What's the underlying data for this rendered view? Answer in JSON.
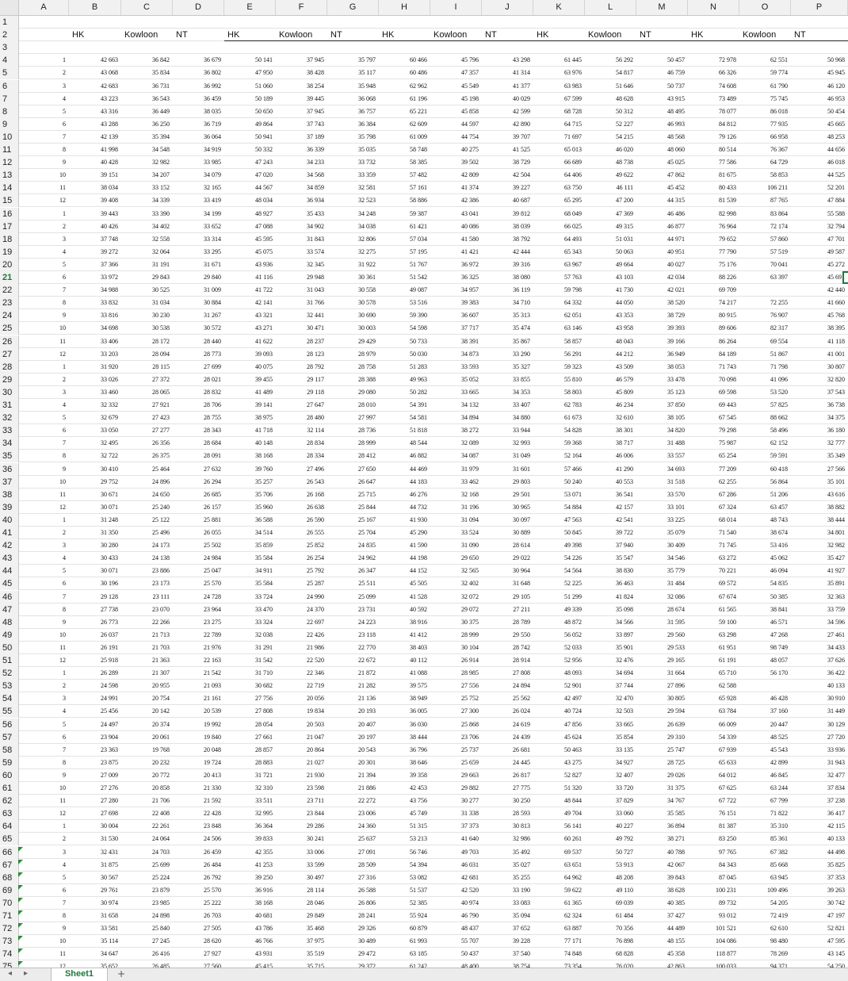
{
  "columns": [
    "A",
    "B",
    "C",
    "D",
    "E",
    "F",
    "G",
    "H",
    "I",
    "J",
    "K",
    "L",
    "M",
    "N",
    "O",
    "P"
  ],
  "header_labels": [
    "HK",
    "Kowloon",
    "NT",
    "HK",
    "Kowloon",
    "NT",
    "HK",
    "Kowloon",
    "NT",
    "HK",
    "Kowloon",
    "NT",
    "HK",
    "Kowloon",
    "NT"
  ],
  "selected_row": 21,
  "flag_rows": [
    66,
    67,
    68,
    69,
    70,
    71,
    72,
    73,
    74,
    75
  ],
  "rows": [
    [
      "1",
      "42 663",
      "36 842",
      "36 679",
      "50 141",
      "37 945",
      "35 797",
      "60 466",
      "45 796",
      "43 298",
      "61 445",
      "56 292",
      "50 457",
      "72 978",
      "62 551",
      "50 968"
    ],
    [
      "2",
      "43 068",
      "35 834",
      "36 802",
      "47 950",
      "38 428",
      "35 117",
      "60 486",
      "47 357",
      "41 314",
      "63 976",
      "54 817",
      "46 759",
      "66 326",
      "59 774",
      "45 945"
    ],
    [
      "3",
      "42 683",
      "36 731",
      "36 992",
      "51 060",
      "38 254",
      "35 948",
      "62 962",
      "45 549",
      "41 377",
      "63 983",
      "51 646",
      "50 737",
      "74 608",
      "61 790",
      "46 120"
    ],
    [
      "4",
      "43 223",
      "36 543",
      "36 459",
      "50 189",
      "39 445",
      "36 068",
      "61 196",
      "45 198",
      "40 029",
      "67 599",
      "48 628",
      "43 915",
      "73 489",
      "75 745",
      "46 953"
    ],
    [
      "5",
      "43 316",
      "36 449",
      "38 035",
      "50 650",
      "37 945",
      "36 757",
      "65 221",
      "45 858",
      "42 599",
      "68 728",
      "50 312",
      "48 495",
      "78 077",
      "86 018",
      "50 454"
    ],
    [
      "6",
      "43 288",
      "36 250",
      "36 719",
      "49 864",
      "37 743",
      "36 384",
      "62 609",
      "44 597",
      "42 890",
      "64 715",
      "52 227",
      "46 993",
      "84 812",
      "77 935",
      "45 665"
    ],
    [
      "7",
      "42 139",
      "35 394",
      "36 064",
      "50 941",
      "37 189",
      "35 798",
      "61 009",
      "44 754",
      "39 707",
      "71 697",
      "54 215",
      "48 568",
      "79 126",
      "66 958",
      "48 253"
    ],
    [
      "8",
      "41 998",
      "34 548",
      "34 919",
      "50 332",
      "36 339",
      "35 035",
      "58 748",
      "40 275",
      "41 525",
      "65 013",
      "46 020",
      "48 060",
      "80 514",
      "76 367",
      "44 656"
    ],
    [
      "9",
      "40 428",
      "32 982",
      "33 985",
      "47 243",
      "34 233",
      "33 732",
      "58 385",
      "39 502",
      "38 729",
      "66 689",
      "48 738",
      "45 025",
      "77 586",
      "64 729",
      "46 018"
    ],
    [
      "10",
      "39 151",
      "34 207",
      "34 079",
      "47 020",
      "34 568",
      "33 359",
      "57 482",
      "42 809",
      "42 504",
      "64 406",
      "49 622",
      "47 862",
      "81 675",
      "58 853",
      "44 525"
    ],
    [
      "11",
      "38 034",
      "33 152",
      "32 165",
      "44 567",
      "34 859",
      "32 581",
      "57 161",
      "41 374",
      "39 227",
      "63 750",
      "46 111",
      "45 452",
      "80 433",
      "106 211",
      "52 201"
    ],
    [
      "12",
      "39 408",
      "34 339",
      "33 419",
      "48 034",
      "36 934",
      "32 523",
      "58 886",
      "42 386",
      "40 687",
      "65 295",
      "47 200",
      "44 315",
      "81 539",
      "87 765",
      "47 884"
    ],
    [
      "1",
      "39 443",
      "33 390",
      "34 199",
      "48 927",
      "35 433",
      "34 248",
      "59 387",
      "43 041",
      "39 812",
      "68 049",
      "47 369",
      "46 486",
      "82 998",
      "83 864",
      "55 588"
    ],
    [
      "2",
      "40 426",
      "34 402",
      "33 652",
      "47 088",
      "34 902",
      "34 038",
      "61 421",
      "40 086",
      "38 039",
      "66 025",
      "49 315",
      "46 877",
      "76 964",
      "72 174",
      "32 794"
    ],
    [
      "3",
      "37 748",
      "32 558",
      "33 314",
      "45 595",
      "31 843",
      "32 806",
      "57 034",
      "41 580",
      "38 792",
      "64 493",
      "51 031",
      "44 971",
      "79 652",
      "57 860",
      "47 701"
    ],
    [
      "4",
      "39 272",
      "32 064",
      "33 295",
      "45 075",
      "33 574",
      "32 275",
      "57 195",
      "41 421",
      "42 444",
      "65 343",
      "50 063",
      "40 951",
      "77 790",
      "57 519",
      "49 587"
    ],
    [
      "5",
      "37 366",
      "31 191",
      "31 671",
      "43 936",
      "32 345",
      "31 922",
      "51 767",
      "36 972",
      "39 316",
      "63 967",
      "49 664",
      "40 027",
      "75 176",
      "70 041",
      "45 272"
    ],
    [
      "6",
      "33 972",
      "29 843",
      "29 840",
      "41 116",
      "29 948",
      "30 361",
      "51 542",
      "36 325",
      "38 080",
      "57 763",
      "43 103",
      "42 034",
      "88 226",
      "63 397",
      "45 691"
    ],
    [
      "7",
      "34 988",
      "30 525",
      "31 009",
      "41 722",
      "31 043",
      "30 558",
      "49 087",
      "34 957",
      "36 119",
      "59 798",
      "41 730",
      "42 021",
      "69 709",
      "",
      "42 440"
    ],
    [
      "8",
      "33 832",
      "31 034",
      "30 884",
      "42 141",
      "31 766",
      "30 578",
      "53 516",
      "39 383",
      "34 710",
      "64 332",
      "44 050",
      "38 520",
      "74 217",
      "72 255",
      "41 660"
    ],
    [
      "9",
      "33 816",
      "30 230",
      "31 267",
      "43 321",
      "32 441",
      "30 690",
      "59 390",
      "36 607",
      "35 313",
      "62 051",
      "43 353",
      "38 729",
      "80 915",
      "76 907",
      "45 768"
    ],
    [
      "10",
      "34 698",
      "30 538",
      "30 572",
      "43 271",
      "30 471",
      "30 003",
      "54 598",
      "37 717",
      "35 474",
      "63 146",
      "43 958",
      "39 393",
      "89 606",
      "82 317",
      "38 395"
    ],
    [
      "11",
      "33 406",
      "28 172",
      "28 440",
      "41 622",
      "28 237",
      "29 429",
      "50 733",
      "38 391",
      "35 867",
      "58 857",
      "48 043",
      "39 166",
      "86 264",
      "69 554",
      "41 118"
    ],
    [
      "12",
      "33 203",
      "28 094",
      "28 773",
      "39 093",
      "28 123",
      "28 979",
      "50 030",
      "34 873",
      "33 290",
      "56 291",
      "44 212",
      "36 949",
      "84 189",
      "51 867",
      "41 001"
    ],
    [
      "1",
      "31 920",
      "28 115",
      "27 699",
      "40 075",
      "28 792",
      "28 758",
      "51 283",
      "33 593",
      "35 327",
      "59 323",
      "43 509",
      "38 053",
      "71 743",
      "71 798",
      "30 807"
    ],
    [
      "2",
      "33 026",
      "27 372",
      "28 021",
      "39 455",
      "29 117",
      "28 388",
      "49 963",
      "35 052",
      "33 855",
      "55 810",
      "46 579",
      "33 478",
      "70 098",
      "41 096",
      "32 820"
    ],
    [
      "3",
      "33 460",
      "28 065",
      "28 832",
      "41 489",
      "29 118",
      "29 080",
      "50 282",
      "33 665",
      "34 353",
      "58 803",
      "45 809",
      "35 123",
      "69 598",
      "53 520",
      "37 543"
    ],
    [
      "4",
      "32 332",
      "27 921",
      "28 706",
      "39 141",
      "27 647",
      "28 010",
      "54 391",
      "34 132",
      "33 407",
      "62 783",
      "46 234",
      "37 850",
      "69 443",
      "57 825",
      "36 738"
    ],
    [
      "5",
      "32 679",
      "27 423",
      "28 755",
      "38 975",
      "28 480",
      "27 997",
      "54 581",
      "34 894",
      "34 880",
      "61 673",
      "32 610",
      "38 105",
      "67 545",
      "88 662",
      "34 375"
    ],
    [
      "6",
      "33 050",
      "27 277",
      "28 343",
      "41 718",
      "32 114",
      "28 736",
      "51 818",
      "38 272",
      "33 944",
      "54 828",
      "38 301",
      "34 820",
      "79 298",
      "58 496",
      "36 180"
    ],
    [
      "7",
      "32 495",
      "26 356",
      "28 684",
      "40 148",
      "28 834",
      "28 999",
      "48 544",
      "32 089",
      "32 993",
      "59 368",
      "38 717",
      "31 488",
      "75 987",
      "62 152",
      "32 777"
    ],
    [
      "8",
      "32 722",
      "26 375",
      "28 091",
      "38 168",
      "28 334",
      "28 412",
      "46 882",
      "34 087",
      "31 049",
      "52 164",
      "46 006",
      "33 557",
      "65 254",
      "59 591",
      "35 349"
    ],
    [
      "9",
      "30 410",
      "25 464",
      "27 632",
      "39 760",
      "27 496",
      "27 650",
      "44 469",
      "31 979",
      "31 601",
      "57 466",
      "41 290",
      "34 693",
      "77 209",
      "60 418",
      "27 566"
    ],
    [
      "10",
      "29 752",
      "24 896",
      "26 294",
      "35 257",
      "26 543",
      "26 647",
      "44 183",
      "33 462",
      "29 803",
      "50 240",
      "40 553",
      "31 518",
      "62 255",
      "56 864",
      "35 101"
    ],
    [
      "11",
      "30 671",
      "24 650",
      "26 685",
      "35 706",
      "26 168",
      "25 715",
      "46 276",
      "32 168",
      "29 501",
      "53 071",
      "36 541",
      "33 570",
      "67 286",
      "51 206",
      "43 616"
    ],
    [
      "12",
      "30 071",
      "25 240",
      "26 157",
      "35 960",
      "26 638",
      "25 844",
      "44 732",
      "31 196",
      "30 965",
      "54 884",
      "42 157",
      "33 101",
      "67 324",
      "63 457",
      "38 882"
    ],
    [
      "1",
      "31 248",
      "25 122",
      "25 881",
      "36 588",
      "26 590",
      "25 167",
      "41 930",
      "31 094",
      "30 097",
      "47 563",
      "42 541",
      "33 225",
      "68 014",
      "48 743",
      "38 444"
    ],
    [
      "2",
      "31 350",
      "25 496",
      "26 055",
      "34 514",
      "26 555",
      "25 704",
      "45 290",
      "33 524",
      "30 889",
      "50 845",
      "39 722",
      "35 079",
      "71 540",
      "38 674",
      "34 801"
    ],
    [
      "3",
      "30 280",
      "24 173",
      "25 502",
      "35 859",
      "25 852",
      "24 835",
      "41 590",
      "31 090",
      "28 614",
      "49 398",
      "37 940",
      "30 409",
      "71 745",
      "53 416",
      "32 982"
    ],
    [
      "4",
      "30 433",
      "24 138",
      "24 984",
      "35 584",
      "26 254",
      "24 962",
      "44 198",
      "29 650",
      "29 022",
      "54 226",
      "35 547",
      "34 546",
      "63 272",
      "45 062",
      "35 427"
    ],
    [
      "5",
      "30 071",
      "23 886",
      "25 047",
      "34 911",
      "25 792",
      "26 347",
      "44 152",
      "32 565",
      "30 964",
      "54 564",
      "38 830",
      "35 779",
      "70 221",
      "46 094",
      "41 927"
    ],
    [
      "6",
      "30 196",
      "23 173",
      "25 570",
      "35 584",
      "25 287",
      "25 511",
      "45 505",
      "32 402",
      "31 648",
      "52 225",
      "36 463",
      "31 484",
      "69 572",
      "54 835",
      "35 891"
    ],
    [
      "7",
      "29 128",
      "23 111",
      "24 728",
      "33 724",
      "24 990",
      "25 099",
      "41 528",
      "32 072",
      "29 105",
      "51 299",
      "41 824",
      "32 086",
      "67 674",
      "50 385",
      "32 363"
    ],
    [
      "8",
      "27 738",
      "23 070",
      "23 964",
      "33 470",
      "24 370",
      "23 731",
      "40 592",
      "29 072",
      "27 211",
      "49 339",
      "35 098",
      "28 674",
      "61 565",
      "38 841",
      "33 759"
    ],
    [
      "9",
      "26 773",
      "22 266",
      "23 275",
      "33 324",
      "22 697",
      "24 223",
      "38 916",
      "30 375",
      "28 789",
      "48 872",
      "34 566",
      "31 595",
      "59 100",
      "46 571",
      "34 596"
    ],
    [
      "10",
      "26 037",
      "21 713",
      "22 789",
      "32 038",
      "22 426",
      "23 118",
      "41 412",
      "28 999",
      "29 550",
      "56 052",
      "33 897",
      "29 560",
      "63 298",
      "47 268",
      "27 461"
    ],
    [
      "11",
      "26 191",
      "21 703",
      "21 976",
      "31 291",
      "21 986",
      "22 770",
      "38 403",
      "30 104",
      "28 742",
      "52 033",
      "35 901",
      "29 533",
      "61 951",
      "98 749",
      "34 433"
    ],
    [
      "12",
      "25 918",
      "21 363",
      "22 163",
      "31 542",
      "22 520",
      "22 672",
      "40 112",
      "26 914",
      "28 914",
      "52 956",
      "32 476",
      "29 165",
      "61 191",
      "48 057",
      "37 626"
    ],
    [
      "1",
      "26 289",
      "21 307",
      "21 542",
      "31 710",
      "22 346",
      "21 872",
      "41 088",
      "28 985",
      "27 808",
      "48 093",
      "34 694",
      "31 664",
      "65 710",
      "56 170",
      "36 422"
    ],
    [
      "2",
      "24 598",
      "20 955",
      "21 093",
      "30 682",
      "22 719",
      "21 282",
      "39 575",
      "27 556",
      "24 894",
      "52 901",
      "37 744",
      "27 896",
      "62 588",
      "",
      "40 133"
    ],
    [
      "3",
      "24 991",
      "20 754",
      "21 161",
      "27 756",
      "20 056",
      "21 136",
      "38 949",
      "25 752",
      "25 562",
      "42 497",
      "32 470",
      "30 805",
      "65 928",
      "46 428",
      "30 910"
    ],
    [
      "4",
      "25 456",
      "20 142",
      "20 539",
      "27 808",
      "19 834",
      "20 193",
      "36 005",
      "27 300",
      "26 024",
      "40 724",
      "32 503",
      "29 594",
      "63 784",
      "37 160",
      "31 449"
    ],
    [
      "5",
      "24 497",
      "20 374",
      "19 992",
      "28 054",
      "20 503",
      "20 407",
      "36 030",
      "25 868",
      "24 619",
      "47 856",
      "33 665",
      "26 639",
      "66 009",
      "20 447",
      "30 129"
    ],
    [
      "6",
      "23 904",
      "20 061",
      "19 840",
      "27 661",
      "21 047",
      "20 197",
      "38 444",
      "23 706",
      "24 439",
      "45 624",
      "35 854",
      "29 310",
      "54 339",
      "48 525",
      "27 720"
    ],
    [
      "7",
      "23 363",
      "19 768",
      "20 048",
      "28 857",
      "20 864",
      "20 543",
      "36 796",
      "25 737",
      "26 681",
      "50 463",
      "33 135",
      "25 747",
      "67 939",
      "45 543",
      "33 936"
    ],
    [
      "8",
      "23 875",
      "20 232",
      "19 724",
      "28 883",
      "21 027",
      "20 301",
      "38 646",
      "25 659",
      "24 445",
      "43 275",
      "34 927",
      "28 725",
      "65 633",
      "42 899",
      "31 943"
    ],
    [
      "9",
      "27 009",
      "20 772",
      "20 413",
      "31 721",
      "21 930",
      "21 394",
      "39 358",
      "29 663",
      "26 817",
      "52 827",
      "32 407",
      "29 026",
      "64 012",
      "46 845",
      "32 477"
    ],
    [
      "10",
      "27 276",
      "20 858",
      "21 330",
      "32 310",
      "23 598",
      "21 886",
      "42 453",
      "29 882",
      "27 775",
      "51 320",
      "33 720",
      "31 375",
      "67 625",
      "63 244",
      "37 834"
    ],
    [
      "11",
      "27 280",
      "21 706",
      "21 592",
      "33 511",
      "23 711",
      "22 272",
      "43 756",
      "30 277",
      "30 250",
      "48 844",
      "37 829",
      "34 767",
      "67 722",
      "67 799",
      "37 238"
    ],
    [
      "12",
      "27 698",
      "22 408",
      "22 428",
      "32 995",
      "23 844",
      "23 006",
      "45 749",
      "31 338",
      "28 593",
      "49 704",
      "33 060",
      "35 585",
      "76 151",
      "71 822",
      "36 417"
    ],
    [
      "1",
      "30 004",
      "22 261",
      "23 848",
      "36 364",
      "29 286",
      "24 360",
      "51 315",
      "37 373",
      "30 813",
      "56 141",
      "40 227",
      "36 894",
      "81 387",
      "35 310",
      "42 115"
    ],
    [
      "2",
      "31 530",
      "24 064",
      "24 506",
      "39 833",
      "30 241",
      "25 637",
      "53 213",
      "41 640",
      "32 986",
      "60 261",
      "49 792",
      "38 271",
      "83 250",
      "85 361",
      "40 133"
    ],
    [
      "3",
      "32 431",
      "24 703",
      "26 459",
      "42 355",
      "33 006",
      "27 091",
      "56 746",
      "49 703",
      "35 492",
      "69 537",
      "50 727",
      "40 788",
      "97 765",
      "67 382",
      "44 498"
    ],
    [
      "4",
      "31 875",
      "25 699",
      "26 484",
      "41 253",
      "33 599",
      "28 509",
      "54 394",
      "46 031",
      "35 027",
      "63 651",
      "53 913",
      "42 067",
      "84 343",
      "85 668",
      "35 825"
    ],
    [
      "5",
      "30 567",
      "25 224",
      "26 792",
      "39 250",
      "30 497",
      "27 316",
      "53 082",
      "42 681",
      "35 255",
      "64 962",
      "48 208",
      "39 843",
      "87 045",
      "63 945",
      "37 353"
    ],
    [
      "6",
      "29 761",
      "23 879",
      "25 570",
      "36 916",
      "28 114",
      "26 588",
      "51 537",
      "42 520",
      "33 190",
      "59 622",
      "49 110",
      "38 628",
      "100 231",
      "109 496",
      "39 263"
    ],
    [
      "7",
      "30 974",
      "23 985",
      "25 222",
      "38 168",
      "28 046",
      "26 806",
      "52 385",
      "40 974",
      "33 083",
      "61 365",
      "69 039",
      "40 385",
      "89 732",
      "54 205",
      "30 742"
    ],
    [
      "8",
      "31 658",
      "24 898",
      "26 703",
      "40 681",
      "29 849",
      "28 241",
      "55 924",
      "46 790",
      "35 094",
      "62 324",
      "61 484",
      "37 427",
      "93 012",
      "72 419",
      "47 197"
    ],
    [
      "9",
      "33 581",
      "25 840",
      "27 505",
      "43 786",
      "35 468",
      "29 326",
      "60 879",
      "48 437",
      "37 652",
      "63 887",
      "70 356",
      "44 489",
      "101 521",
      "62 610",
      "52 821"
    ],
    [
      "10",
      "35 114",
      "27 245",
      "28 620",
      "46 766",
      "37 975",
      "30 489",
      "61 993",
      "55 707",
      "39 228",
      "77 171",
      "76 898",
      "48 155",
      "104 086",
      "98 480",
      "47 595"
    ],
    [
      "11",
      "34 647",
      "26 416",
      "27 927",
      "43 931",
      "35 519",
      "29 472",
      "63 185",
      "50 437",
      "37 540",
      "74 848",
      "68 828",
      "45 358",
      "118 877",
      "78 269",
      "43 145"
    ],
    [
      "12",
      "35 652",
      "26 485",
      "27 560",
      "45 415",
      "35 715",
      "29 372",
      "61 242",
      "48 400",
      "38 754",
      "73 354",
      "76 020",
      "42 863",
      "100 033",
      "94 371",
      "54 250"
    ]
  ],
  "tab_bar": {
    "prev_label": "◂",
    "next_label": "▸",
    "sheet_tab_label": "Sheet1",
    "add_tab_label": "+"
  }
}
